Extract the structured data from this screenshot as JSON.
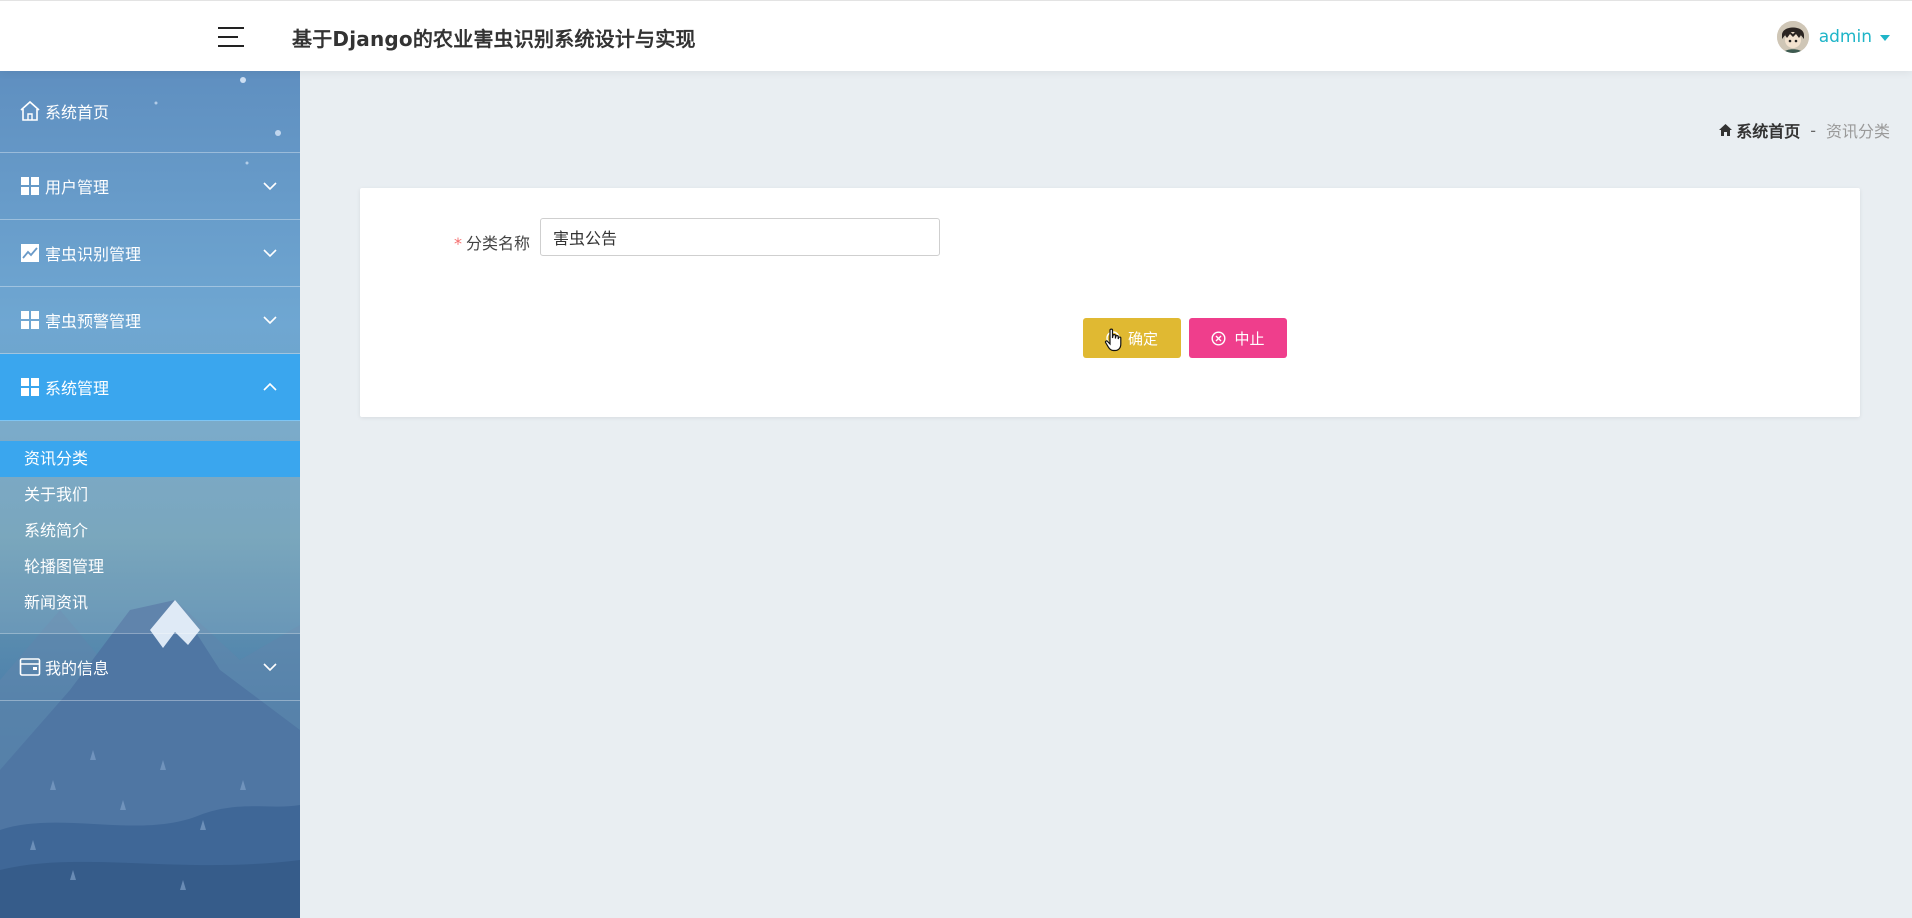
{
  "header": {
    "title": "基于Django的农业害虫识别系统设计与实现",
    "username": "admin"
  },
  "sidebar": {
    "items": [
      {
        "label": "系统首页",
        "icon": "home-icon"
      },
      {
        "label": "用户管理",
        "icon": "grid-icon"
      },
      {
        "label": "害虫识别管理",
        "icon": "chart-icon"
      },
      {
        "label": "害虫预警管理",
        "icon": "grid-icon"
      },
      {
        "label": "系统管理",
        "icon": "grid-icon",
        "expanded": true
      },
      {
        "label": "我的信息",
        "icon": "wallet-icon"
      }
    ],
    "submenu": [
      {
        "label": "资讯分类",
        "active": true
      },
      {
        "label": "关于我们"
      },
      {
        "label": "系统简介"
      },
      {
        "label": "轮播图管理"
      },
      {
        "label": "新闻资讯"
      }
    ]
  },
  "breadcrumb": {
    "home": "系统首页",
    "separator": "-",
    "current": "资讯分类"
  },
  "form": {
    "required_mark": "*",
    "field_label": "分类名称",
    "field_value": "害虫公告",
    "confirm_label": "确定",
    "stop_label": "中止"
  },
  "colors": {
    "accent": "#3aa6ee",
    "confirm": "#e0b932",
    "stop": "#ef3e8c",
    "username": "#1fb5c8"
  }
}
